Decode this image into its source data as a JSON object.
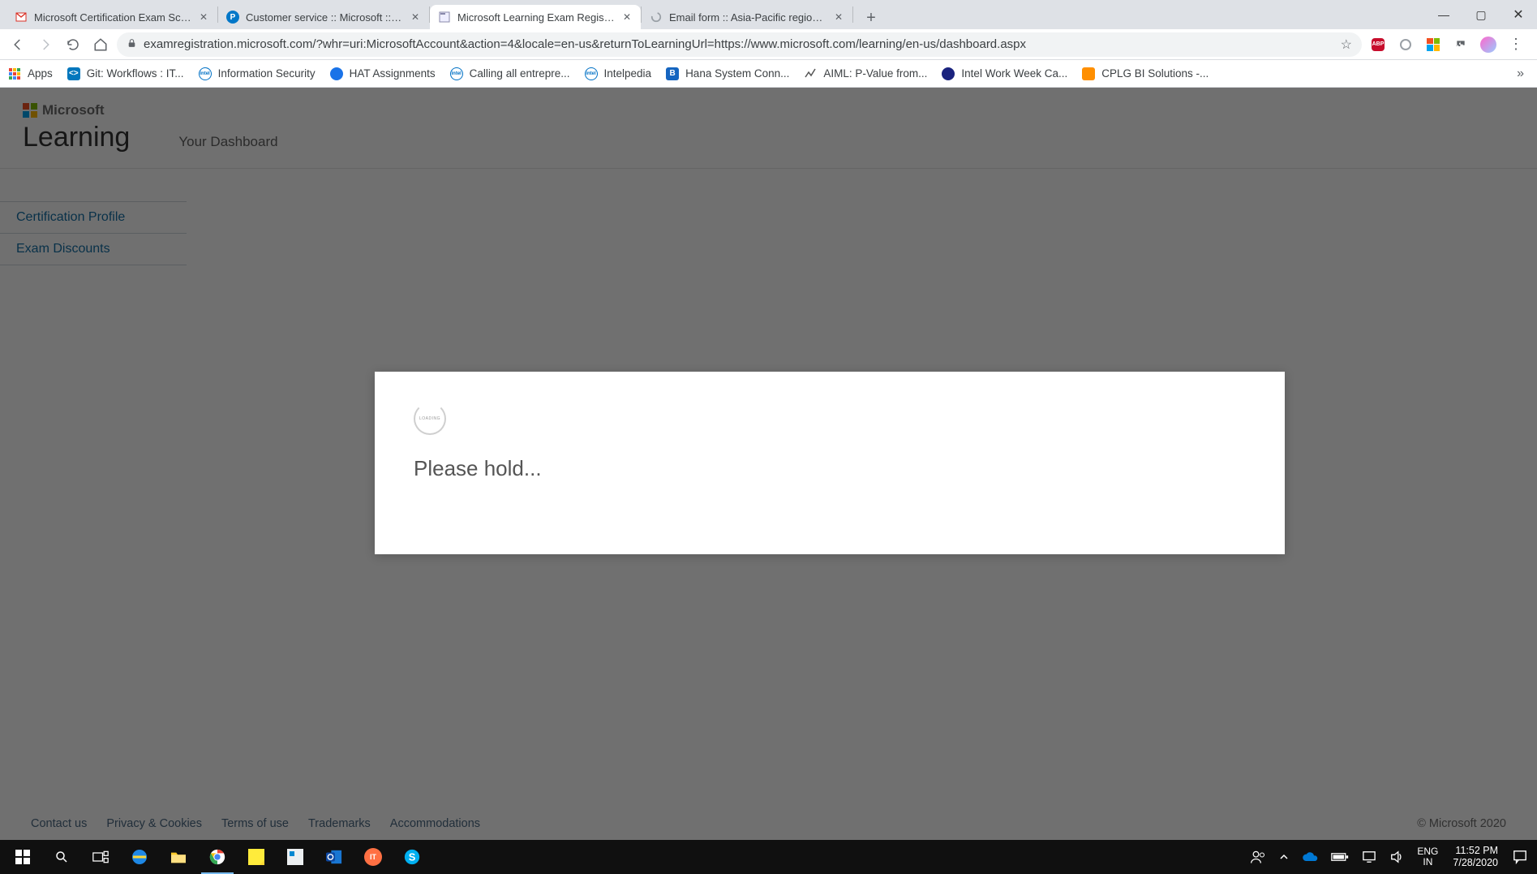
{
  "window_controls": {
    "minimize": "—",
    "maximize": "▢",
    "close": "✕"
  },
  "tabs": [
    {
      "title": "Microsoft Certification Exam Sche",
      "active": false
    },
    {
      "title": "Customer service :: Microsoft :: Pe",
      "active": false
    },
    {
      "title": "Microsoft Learning Exam Registra",
      "active": true
    },
    {
      "title": "Email form :: Asia-Pacific region ::",
      "active": false
    }
  ],
  "new_tab_symbol": "+",
  "nav": {
    "back": "←",
    "forward": "→",
    "reload": "⟳",
    "home": "⌂",
    "url": "examregistration.microsoft.com/?whr=uri:MicrosoftAccount&action=4&locale=en-us&returnToLearningUrl=https://www.microsoft.com/learning/en-us/dashboard.aspx",
    "star": "☆"
  },
  "extensions": {
    "abp": "ABP",
    "circle": "◯",
    "win": "⊞",
    "puzzle": "✦",
    "avatar": "◉",
    "menu": "⋮"
  },
  "bookmarks": {
    "apps_label": "Apps",
    "items": [
      {
        "label": "Git: Workflows : IT..."
      },
      {
        "label": "Information Security"
      },
      {
        "label": "HAT Assignments"
      },
      {
        "label": "Calling all entrepre..."
      },
      {
        "label": "Intelpedia"
      },
      {
        "label": "Hana System Conn..."
      },
      {
        "label": "AIML: P-Value from..."
      },
      {
        "label": "Intel Work Week Ca..."
      },
      {
        "label": "CPLG BI Solutions -..."
      }
    ],
    "overflow": "»"
  },
  "page": {
    "brand": "Microsoft",
    "learning": "Learning",
    "dashboard": "Your Dashboard",
    "side_nav": {
      "cert_profile": "Certification Profile",
      "exam_discounts": "Exam Discounts"
    },
    "footer": {
      "contact": "Contact us",
      "privacy": "Privacy & Cookies",
      "terms": "Terms of use",
      "trademarks": "Trademarks",
      "accommodations": "Accommodations",
      "copyright": "© Microsoft 2020"
    },
    "modal_message": "Please hold..."
  },
  "taskbar": {
    "lang1": "ENG",
    "lang2": "IN",
    "time": "11:52 PM",
    "date": "7/28/2020"
  }
}
